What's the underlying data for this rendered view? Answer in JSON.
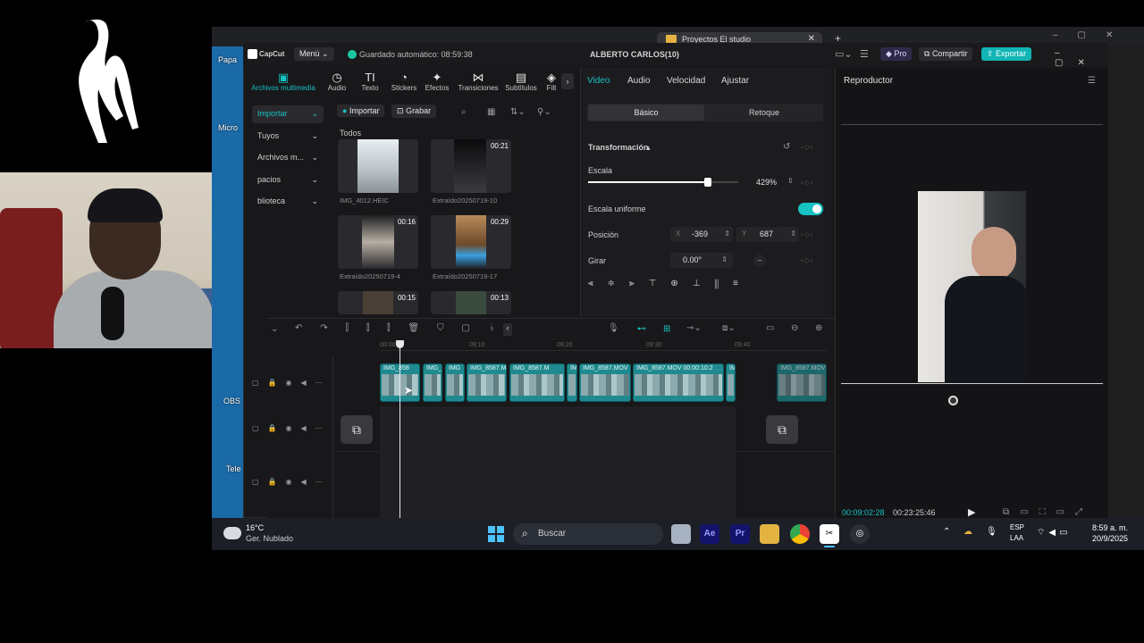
{
  "colors": {
    "accent": "#00c7c7",
    "pro": "#7b6cf6",
    "share": "#2d6ff0",
    "export": "#12b5b5",
    "clip": "#1f8a8f"
  },
  "browser": {
    "tab_title": "Proyectos El studio"
  },
  "desktop_icons": [
    "Papa",
    "Micro",
    "OBS",
    "Tele"
  ],
  "titlebar": {
    "app_name": "CapCut",
    "menu_label": "Menú",
    "autosave": "Guardado automático: 08:59:38",
    "project_title": "ALBERTO CARLOS(10)",
    "pro_label": "Pro",
    "share_label": "Compartir",
    "export_label": "Exportar"
  },
  "media_toolbar": [
    {
      "icon": "media-icon",
      "label": "Archivos multimedia"
    },
    {
      "icon": "audio-icon",
      "label": "Audio"
    },
    {
      "icon": "text-icon",
      "label": "Texto"
    },
    {
      "icon": "stickers-icon",
      "label": "Stickers"
    },
    {
      "icon": "effects-icon",
      "label": "Efectos"
    },
    {
      "icon": "transitions-icon",
      "label": "Transiciones"
    },
    {
      "icon": "subtitles-icon",
      "label": "Subtítulos"
    },
    {
      "icon": "filters-icon",
      "label": "Filt"
    }
  ],
  "sidebar": {
    "items": [
      {
        "label": "Importar"
      },
      {
        "label": "Tuyos"
      },
      {
        "label": "Archivos m..."
      },
      {
        "label": "pacios"
      },
      {
        "label": "blioteca"
      }
    ]
  },
  "media": {
    "import_label": "Importar",
    "record_label": "Grabar",
    "section_label": "Todos",
    "thumbs": [
      {
        "caption": "IMG_4012.HEIC",
        "duration": ""
      },
      {
        "caption": "Extraído20250719-10",
        "duration": "00:21"
      },
      {
        "caption": "Extraído20250719-4",
        "duration": "00:16"
      },
      {
        "caption": "Extraído20250719-17",
        "duration": "00:29"
      },
      {
        "caption": "",
        "duration": "00:15"
      },
      {
        "caption": "",
        "duration": "00:13"
      }
    ]
  },
  "props": {
    "tabs": [
      "Video",
      "Audio",
      "Velocidad",
      "Ajustar"
    ],
    "subtabs": [
      "Básico",
      "Retoque"
    ],
    "section": "Transformación",
    "scale_label": "Escala",
    "scale_value": "429%",
    "scale_fraction": 0.8,
    "uniform_label": "Escala uniforme",
    "position_label": "Posición",
    "pos_x_label": "X",
    "pos_x": "-369",
    "pos_y_label": "Y",
    "pos_y": "687",
    "rotate_label": "Girar",
    "rotate_value": "0.00°"
  },
  "player": {
    "title": "Reproductor",
    "current_time": "00:09:02:28",
    "total_time": "00:23:25:46"
  },
  "timeline": {
    "ruler": [
      "00:00",
      "09:10",
      "09:20",
      "09:30",
      "09:40"
    ],
    "clips": [
      {
        "label": "IMG_858"
      },
      {
        "label": "IMG_"
      },
      {
        "label": "IMG"
      },
      {
        "label": "IMG_8587.M"
      },
      {
        "label": "IMG_8587.M"
      },
      {
        "label": "IM"
      },
      {
        "label": "IMG_8587.MOV"
      },
      {
        "label": "IMG_8587.MOV   00:00:10:2"
      },
      {
        "label": "IM"
      },
      {
        "label": "IMG_8587.MOV"
      }
    ]
  },
  "taskbar": {
    "temp": "16°C",
    "weather": "Ger. Nublado",
    "search": "Buscar",
    "lang1": "ESP",
    "lang2": "LAA",
    "time": "8:59 a. m.",
    "date": "20/9/2025",
    "apps": [
      "Ae",
      "Pr"
    ]
  }
}
